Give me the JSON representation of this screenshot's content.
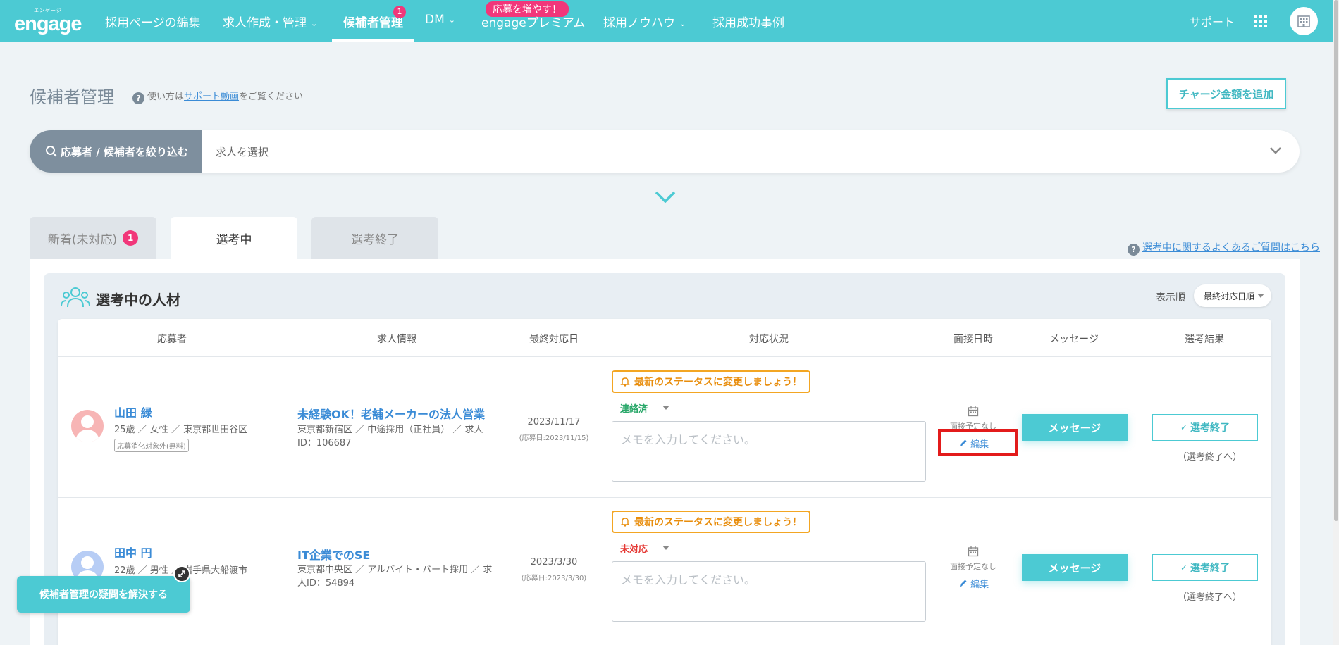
{
  "nav": {
    "logo_kana": "エンゲージ",
    "logo_text": "engage",
    "items": [
      {
        "label": "採用ページの編集"
      },
      {
        "label": "求人作成・管理"
      },
      {
        "label": "候補者管理",
        "badge": "1"
      },
      {
        "label": "DM"
      },
      {
        "label": "engageプレミアム",
        "promo": "応募を増やす！"
      },
      {
        "label": "採用ノウハウ"
      },
      {
        "label": "採用成功事例"
      }
    ],
    "support": "サポート",
    "accent_color": "#4ccad3",
    "badge_color": "#f1377a"
  },
  "header": {
    "title": "候補者管理",
    "help_prefix": "使い方は",
    "help_link": "サポート動画",
    "help_suffix": "をご覧ください",
    "charge_button": "チャージ金額を追加"
  },
  "filter": {
    "label": "応募者 / 候補者を絞り込む",
    "select_value": "求人を選択"
  },
  "tabs": [
    {
      "label": "新着(未対応)",
      "badge": "1"
    },
    {
      "label": "選考中"
    },
    {
      "label": "選考終了"
    }
  ],
  "faq_link": "選考中に関するよくあるご質問はこちら",
  "panel": {
    "title": "選考中の人材",
    "sort_label": "表示順",
    "sort_value": "最終対応日順"
  },
  "table": {
    "headers": [
      "応募者",
      "求人情報",
      "最終対応日",
      "対応状況",
      "面接日時",
      "メッセージ",
      "選考結果"
    ],
    "rows": [
      {
        "name": "山田 緑",
        "meta": "25歳 ／ 女性 ／ 東京都世田谷区",
        "tag": "応募消化対象外(無料)",
        "job_title": "未経験OK！老舗メーカーの法人営業",
        "job_meta": "東京都新宿区 ／ 中途採用（正社員） ／ 求人ID：106687",
        "date": "2023/11/17",
        "date_sub": "(応募日:2023/11/15)",
        "alert": "最新のステータスに変更しましょう！",
        "status": "連絡済",
        "status_color": "#2aa86a",
        "memo_placeholder": "メモを入力してください。",
        "interview": "面接予定なし",
        "edit": "編集",
        "message_button": "メッセージ",
        "end_button": "選考終了",
        "end_sub": "（選考終了へ）",
        "avatar_color": "#f7b5b5"
      },
      {
        "name": "田中 円",
        "meta": "22歳 ／ 男性 ／ 岩手県大船渡市",
        "job_title": "IT企業でのSE",
        "job_meta": "東京都中央区 ／ アルバイト・パート採用 ／ 求人ID：54894",
        "date": "2023/3/30",
        "date_sub": "(応募日:2023/3/30)",
        "alert": "最新のステータスに変更しましょう！",
        "status": "未対応",
        "status_color": "#e53935",
        "memo_placeholder": "メモを入力してください。",
        "interview": "面接予定なし",
        "edit": "編集",
        "message_button": "メッセージ",
        "end_button": "選考終了",
        "end_sub": "（選考終了へ）",
        "avatar_color": "#b7cdf5"
      }
    ]
  },
  "float_help": "候補者管理の疑問を解決する"
}
